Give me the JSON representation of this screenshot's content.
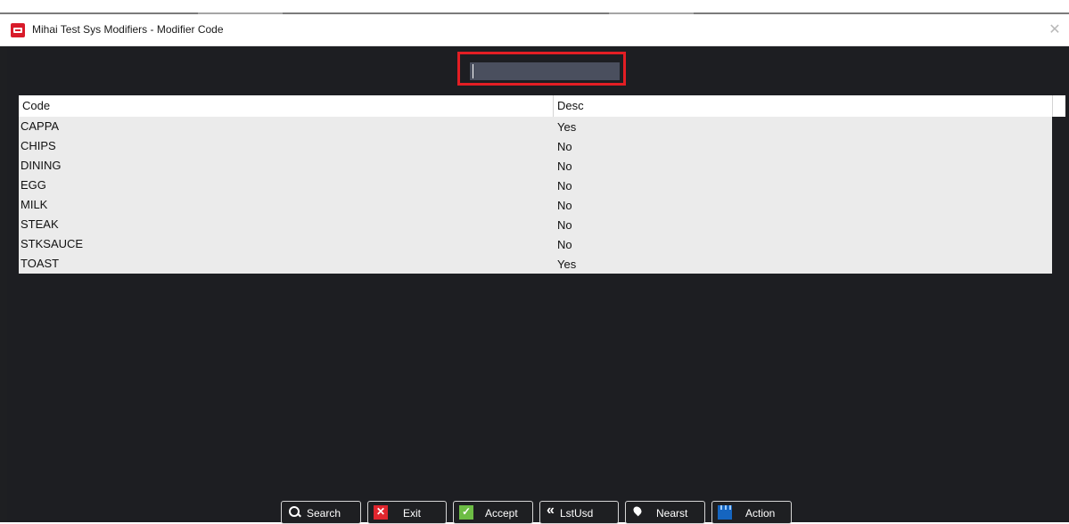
{
  "window": {
    "title": "Mihai Test Sys Modifiers - Modifier Code",
    "close_glyph": "✕"
  },
  "search": {
    "value": "",
    "placeholder": ""
  },
  "grid": {
    "columns": {
      "code": "Code",
      "desc": "Desc"
    },
    "rows": [
      {
        "code": "CAPPA",
        "desc": "Yes"
      },
      {
        "code": "CHIPS",
        "desc": "No"
      },
      {
        "code": "DINING",
        "desc": "No"
      },
      {
        "code": "EGG",
        "desc": "No"
      },
      {
        "code": "MILK",
        "desc": "No"
      },
      {
        "code": "STEAK",
        "desc": "No"
      },
      {
        "code": "STKSAUCE",
        "desc": "No"
      },
      {
        "code": "TOAST",
        "desc": "Yes"
      }
    ]
  },
  "toolbar": {
    "search_label": "Search",
    "exit_label": "Exit",
    "accept_label": "Accept",
    "lastused_label": "LstUsd",
    "nearest_label": "Nearst",
    "action_label": "Action"
  },
  "colors": {
    "background": "#1e1f22",
    "highlight_border": "#e31e24",
    "input_bg": "#4a4f5e",
    "grid_row_bg": "#ebebeb"
  },
  "icons": {
    "app": "app-logo-icon",
    "search": "magnifier-icon",
    "exit": "x-icon",
    "accept": "checkmark-icon",
    "last_used": "double-chevron-left-icon",
    "nearest": "pin-icon",
    "action": "clapperboard-icon"
  }
}
